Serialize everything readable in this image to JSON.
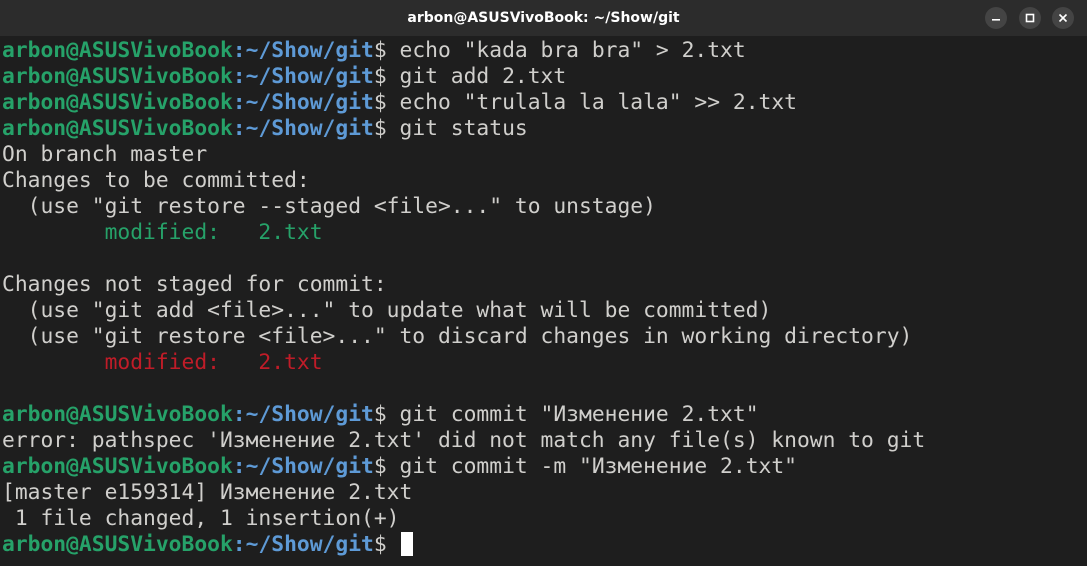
{
  "window": {
    "title": "arbon@ASUSVivoBook: ~/Show/git"
  },
  "prompt": {
    "user": "arbon@ASUSVivoBook",
    "path": ":~/Show/git",
    "symbol": "$ "
  },
  "lines": [
    {
      "cmd": "echo \"kada bra bra\" > 2.txt"
    },
    {
      "cmd": "git add 2.txt"
    },
    {
      "cmd": "echo \"trulala la lala\" >> 2.txt"
    },
    {
      "cmd": "git status"
    },
    {
      "text": "On branch master"
    },
    {
      "text": "Changes to be committed:"
    },
    {
      "text": "  (use \"git restore --staged <file>...\" to unstage)"
    },
    {
      "text": "        modified:   2.txt",
      "color": "green"
    },
    {
      "text": ""
    },
    {
      "text": "Changes not staged for commit:"
    },
    {
      "text": "  (use \"git add <file>...\" to update what will be committed)"
    },
    {
      "text": "  (use \"git restore <file>...\" to discard changes in working directory)"
    },
    {
      "text": "        modified:   2.txt",
      "color": "red"
    },
    {
      "text": ""
    },
    {
      "cmd": "git commit \"Изменение 2.txt\""
    },
    {
      "text": "error: pathspec 'Изменение 2.txt' did not match any file(s) known to git"
    },
    {
      "cmd": "git commit -m \"Изменение 2.txt\""
    },
    {
      "text": "[master e159314] Изменение 2.txt"
    },
    {
      "text": " 1 file changed, 1 insertion(+)"
    },
    {
      "cmd": "",
      "cursor": true
    }
  ],
  "colors": {
    "background": "#1e1e1e",
    "titlebar": "#2c2c2c",
    "prompt_user": "#26a269",
    "prompt_path": "#5e9ad6",
    "staged": "#26a269",
    "unstaged": "#c01c28",
    "text": "#d0cfcc"
  },
  "icons": [
    "minimize-icon",
    "maximize-icon",
    "close-icon"
  ]
}
